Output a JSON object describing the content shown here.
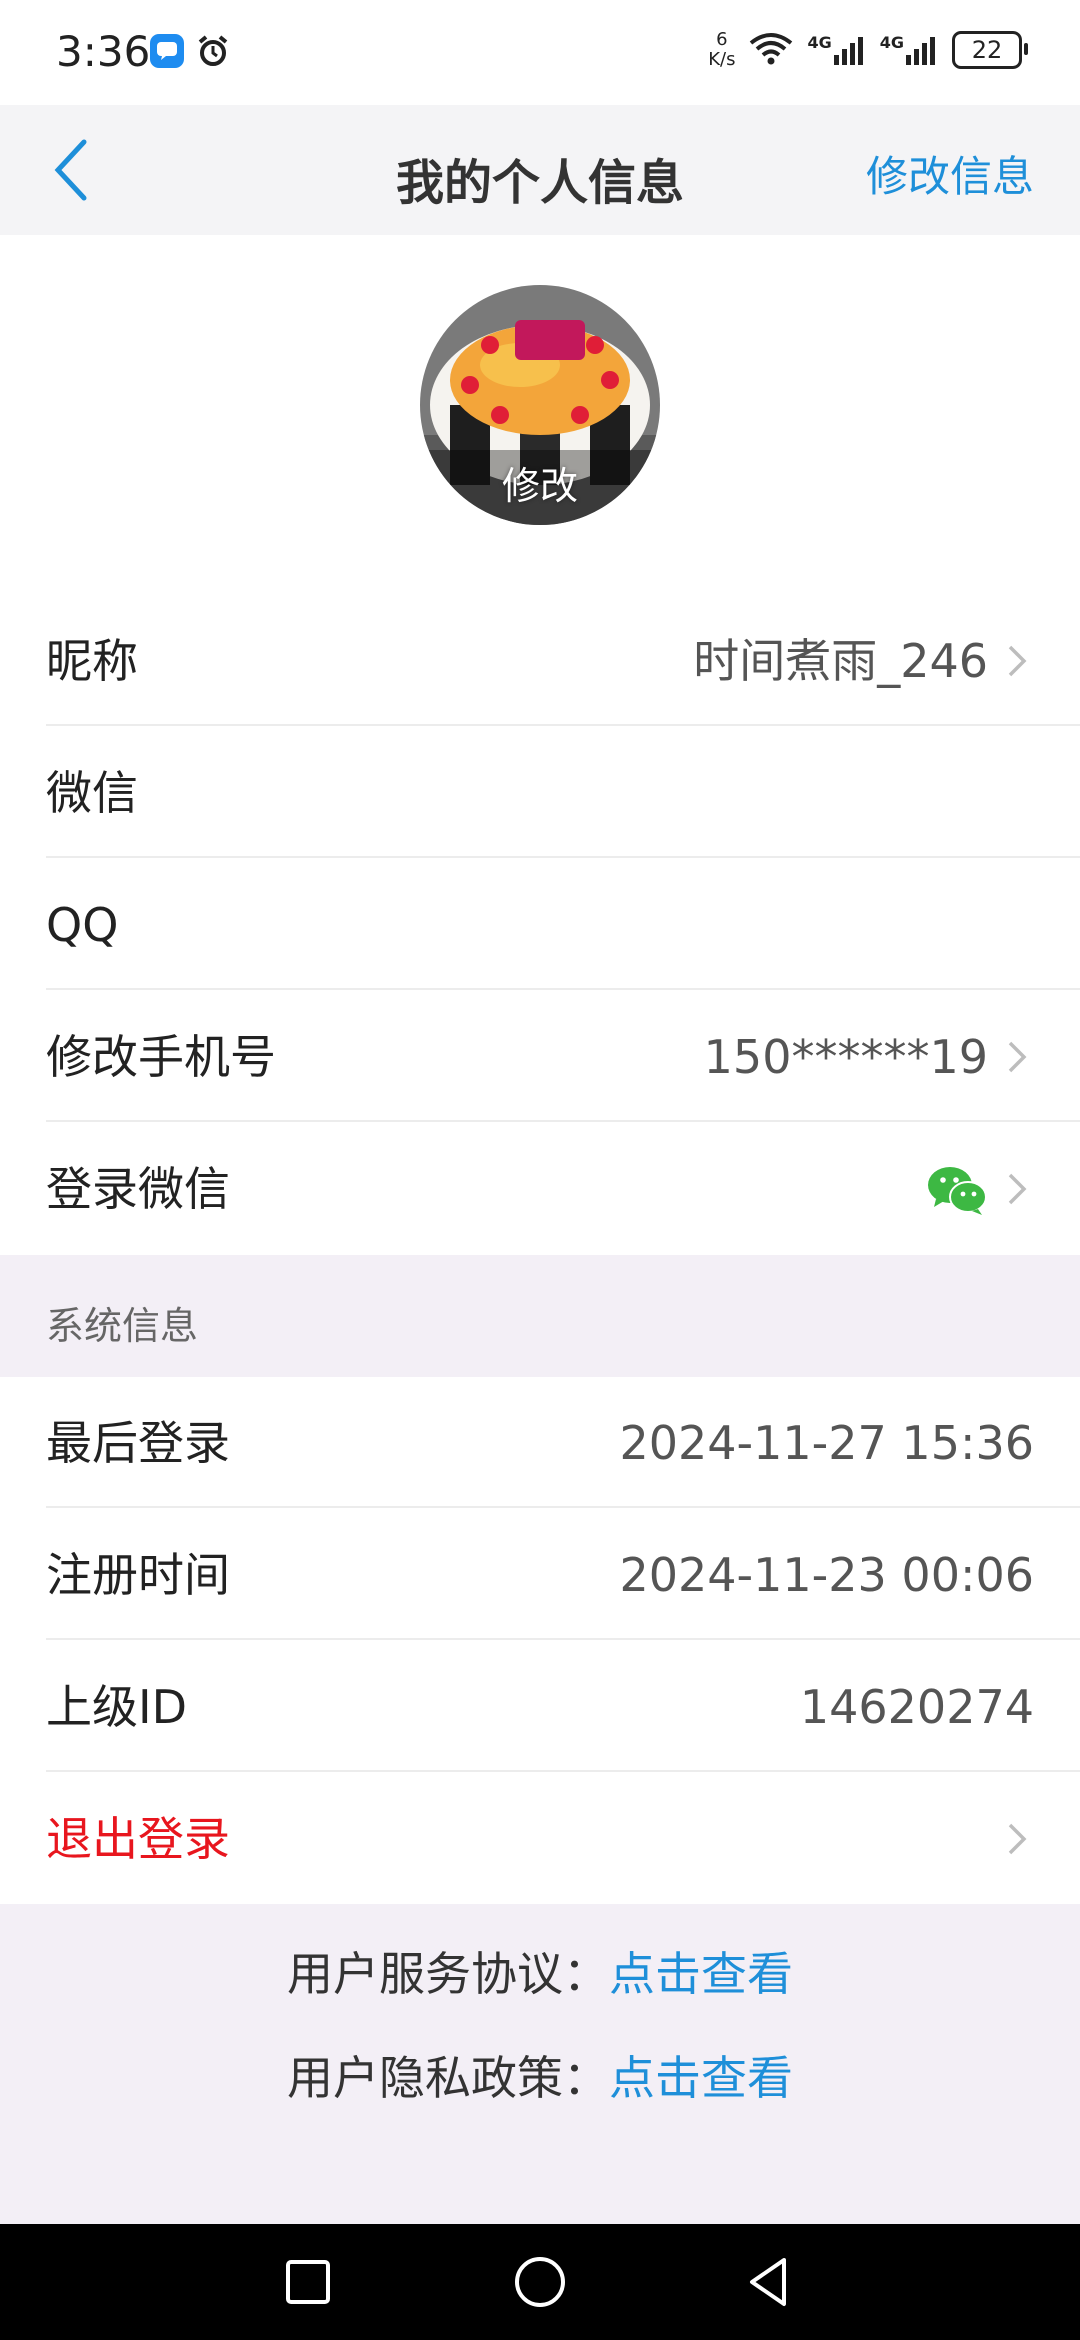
{
  "status_bar": {
    "time": "3:36",
    "net_speed_value": "6",
    "net_speed_unit": "K/s",
    "signal_1": "4G",
    "signal_2": "4G",
    "battery": "22"
  },
  "nav": {
    "title": "我的个人信息",
    "edit_label": "修改信息"
  },
  "avatar": {
    "edit_label": "修改"
  },
  "profile_rows": [
    {
      "label": "昵称",
      "value": "时间煮雨_246"
    },
    {
      "label": "微信",
      "value": ""
    },
    {
      "label": "QQ",
      "value": ""
    },
    {
      "label": "修改手机号",
      "value": "150******19"
    },
    {
      "label": "登录微信",
      "icon": "wechat-icon"
    }
  ],
  "system_section": {
    "title": "系统信息",
    "rows": [
      {
        "label": "最后登录",
        "value": "2024-11-27 15:36"
      },
      {
        "label": "注册时间",
        "value": "2024-11-23 00:06"
      },
      {
        "label": "上级ID",
        "value": "14620274"
      }
    ],
    "logout_label": "退出登录"
  },
  "footer": {
    "service_label": "用户服务协议：",
    "service_link": "点击查看",
    "privacy_label": "用户隐私政策：",
    "privacy_link": "点击查看"
  },
  "colors": {
    "accent": "#1E8FD9",
    "danger": "#E8161E",
    "wechat": "#3DB843"
  }
}
